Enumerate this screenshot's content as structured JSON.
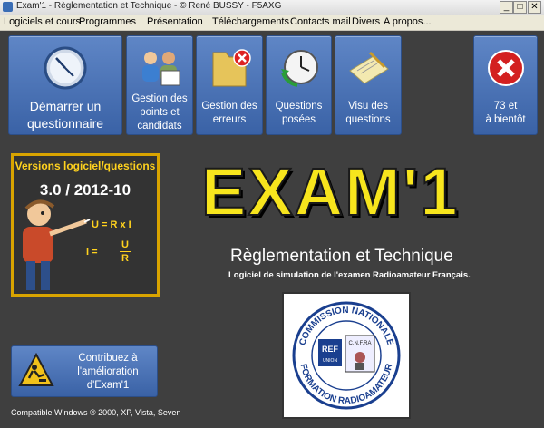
{
  "window": {
    "title": "Exam'1 - Règlementation et Technique - © René BUSSY - F5AXG",
    "minimize": "_",
    "maximize": "□",
    "close": "✕"
  },
  "menu": [
    "Logiciels et cours",
    "Programmes",
    "Présentation",
    "Téléchargements",
    "Contacts mail",
    "Divers",
    "A propos..."
  ],
  "tiles": [
    {
      "line1": "Démarrer un",
      "line2": "questionnaire",
      "icon": "clock-icon"
    },
    {
      "line1": "Gestion des",
      "line2": "points et",
      "line3": "candidats",
      "icon": "people-icon"
    },
    {
      "line1": "Gestion des",
      "line2": "erreurs",
      "icon": "folder-error-icon"
    },
    {
      "line1": "Questions",
      "line2": "posées",
      "icon": "history-clock-icon"
    },
    {
      "line1": "Visu des",
      "line2": "questions",
      "icon": "notepad-icon"
    },
    {
      "line1": "73 et",
      "line2": "à bientôt",
      "icon": "close-icon"
    }
  ],
  "board": {
    "title": "Versions logiciel/questions",
    "version": "3.0  /  2012-10",
    "formula1": "U = R x I",
    "formula2_left": "I =",
    "formula2_num": "U",
    "formula2_den": "R"
  },
  "logo": "EXAM'1",
  "subtitle": "Règlementation et Technique",
  "tagline": "Logiciel de simulation de l'examen Radioamateur Français.",
  "cnfra": {
    "top": "COMMISSION NATIONALE",
    "bottom": "FORMATION RADIOAMATEUR",
    "ref": "REF",
    "ref_sub": "UNION",
    "abbr": "C.N.F.RA"
  },
  "contrib": {
    "line1": "Contribuez à",
    "line2": "l'amélioration",
    "line3": "d'Exam'1"
  },
  "footer": "Compatible Windows ® 2000, XP, Vista, Seven",
  "colors": {
    "tile": "#4a72b6",
    "background": "#3f3f3f",
    "logo": "#f7e51d",
    "board_border": "#d9a400"
  }
}
